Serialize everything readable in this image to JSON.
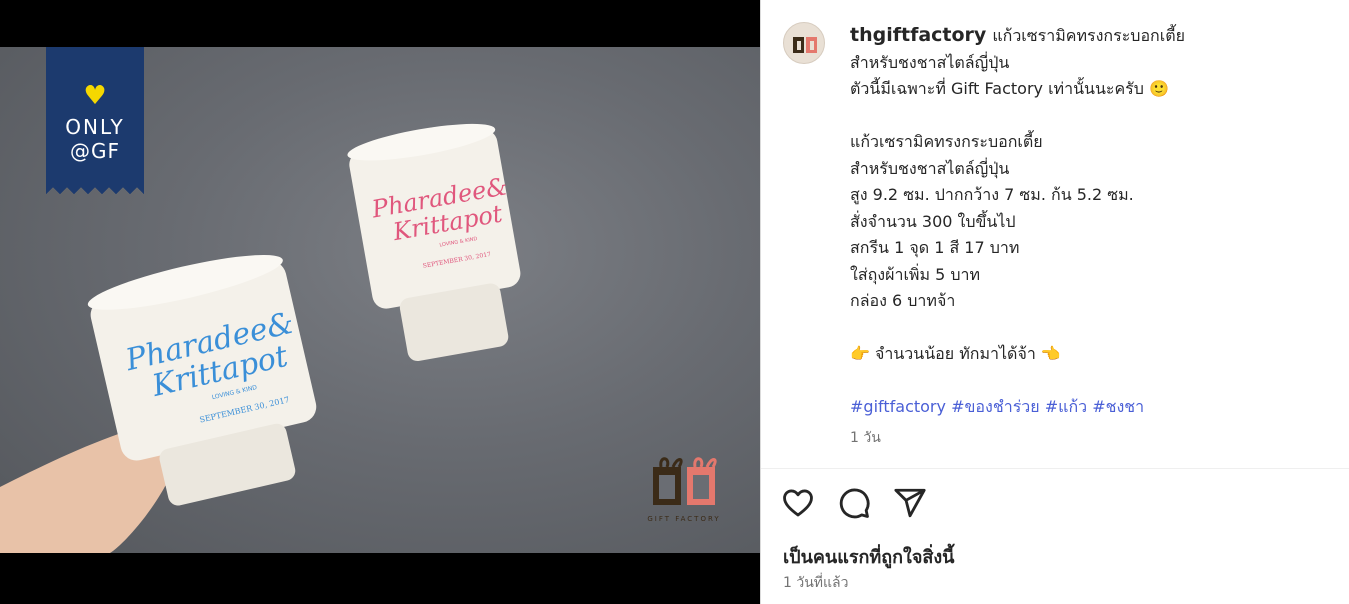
{
  "media": {
    "badge": {
      "line1": "ONLY",
      "line2": "@GF",
      "heart_color": "#f5d800",
      "bg_color": "#1c3a6e"
    },
    "cup_left": {
      "line1": "Pharadee&",
      "line2": "Krittapot",
      "small": "LOVING & KIND",
      "date": "SEPTEMBER 30, 2017",
      "ink": "#3a8fd8"
    },
    "cup_right": {
      "line1": "Pharadee&",
      "line2": "Krittapot",
      "small": "LOVING & KIND",
      "date": "SEPTEMBER 30, 2017",
      "ink": "#e0577d"
    },
    "watermark": {
      "logo": "GF",
      "sub": "GIFT FACTORY"
    }
  },
  "post": {
    "username": "thgiftfactory",
    "caption_lines": [
      "แก้วเซรามิคทรงกระบอกเตี้ย",
      "สำหรับชงชาสไตล์ญี่ปุ่น",
      "ตัวนี้มีเฉพาะที่ Gift Factory เท่านั้นนะครับ 🙂",
      "",
      "แก้วเซรามิคทรงกระบอกเตี้ย",
      "สำหรับชงชาสไตล์ญี่ปุ่น",
      "สูง 9.2 ซม. ปากกว้าง 7 ซม. ก้น 5.2 ซม.",
      "สั่งจำนวน 300 ใบขึ้นไป",
      "สกรีน 1 จุด 1 สี 17 บาท",
      "ใส่ถุงผ้าเพิ่ม 5 บาท",
      "กล่อง 6 บาทจ้า",
      "",
      "👉 จำนวนน้อย ทักมาได้จ้า 👈",
      ""
    ],
    "hashtags": [
      "#giftfactory",
      "#ของชำร่วย",
      "#แก้ว",
      "#ชงชา"
    ],
    "time_short": "1 วัน",
    "likes_text": "เป็นคนแรกที่ถูกใจสิ่งนี้",
    "time_long": "1 วันที่แล้ว",
    "hashtag_color": "#4a5fd6"
  }
}
